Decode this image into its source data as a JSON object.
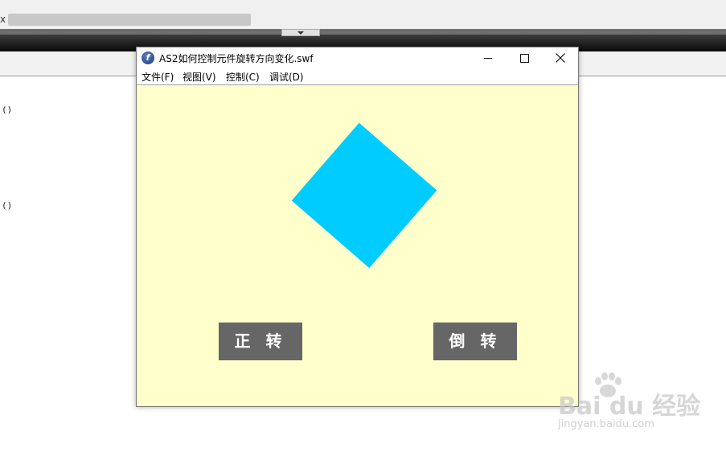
{
  "background": {
    "close_mark": "x",
    "parens": [
      "()",
      "()"
    ]
  },
  "window": {
    "title": "AS2如何控制元件旋转方向变化.swf",
    "icon": "flash-player-icon",
    "controls": {
      "minimize": "minimize-icon",
      "maximize": "maximize-icon",
      "close": "close-icon"
    }
  },
  "menu": {
    "items": [
      {
        "label": "文件(F)"
      },
      {
        "label": "视图(V)"
      },
      {
        "label": "控制(C)"
      },
      {
        "label": "调试(D)"
      }
    ]
  },
  "stage": {
    "background_color": "#ffffcc",
    "shape_color": "#00ccff",
    "shape_rotation_deg": 41,
    "buttons": {
      "forward_label": "正 转",
      "reverse_label": "倒 转",
      "color": "#666666"
    }
  },
  "watermark": {
    "main": "Bai du 经验",
    "sub": "jingyan.baidu.com"
  }
}
